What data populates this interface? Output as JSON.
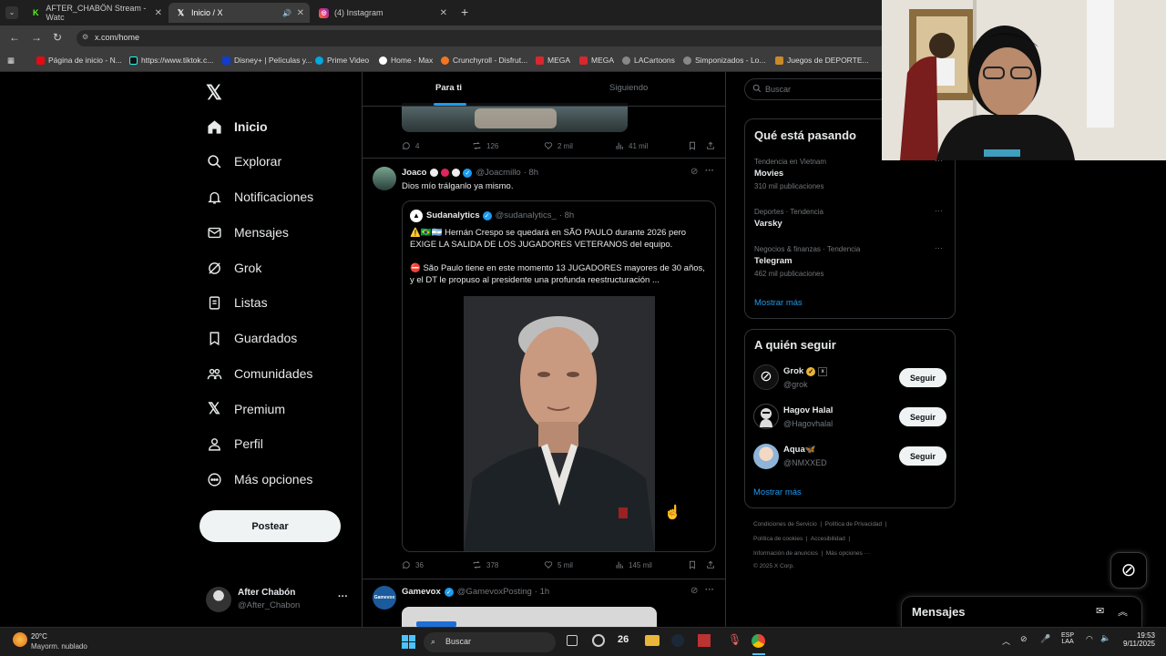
{
  "browser": {
    "tabs": [
      {
        "label": "AFTER_CHABÖN Stream - Watc"
      },
      {
        "label": "Inicio / X"
      },
      {
        "label": "(4) Instagram"
      }
    ],
    "new_tab": "+",
    "url": "x.com/home",
    "bookmarks": [
      {
        "label": "Página de inicio - N..."
      },
      {
        "label": "https://www.tiktok.c..."
      },
      {
        "label": "Disney+ | Películas y..."
      },
      {
        "label": "Prime Video"
      },
      {
        "label": "Home - Max"
      },
      {
        "label": "Crunchyroll - Disfrut..."
      },
      {
        "label": "MEGA"
      },
      {
        "label": "MEGA"
      },
      {
        "label": "LACartoons"
      },
      {
        "label": "Simponizados - Lo..."
      },
      {
        "label": "Juegos de DEPORTE..."
      }
    ]
  },
  "nav": {
    "items": [
      {
        "label": "Inicio",
        "icon": "home-icon"
      },
      {
        "label": "Explorar",
        "icon": "search-icon"
      },
      {
        "label": "Notificaciones",
        "icon": "bell-icon"
      },
      {
        "label": "Mensajes",
        "icon": "mail-icon"
      },
      {
        "label": "Grok",
        "icon": "grok-icon"
      },
      {
        "label": "Listas",
        "icon": "list-icon"
      },
      {
        "label": "Guardados",
        "icon": "bookmark-icon"
      },
      {
        "label": "Comunidades",
        "icon": "communities-icon"
      },
      {
        "label": "Premium",
        "icon": "x-icon"
      },
      {
        "label": "Perfil",
        "icon": "person-icon"
      },
      {
        "label": "Más opciones",
        "icon": "more-icon"
      }
    ],
    "post_button": "Postear",
    "account": {
      "name": "After Chabón",
      "handle": "@After_Chabon",
      "more": "···"
    }
  },
  "timeline": {
    "tabs": {
      "for_you": "Para ti",
      "following": "Siguiendo"
    },
    "prev_post_actions": {
      "replies": "4",
      "reposts": "126",
      "likes": "2 mil",
      "views": "41 mil"
    },
    "post": {
      "author": "Joaco",
      "handle": "@Joacmillo",
      "time": "· 8h",
      "text": "Dios mío trálganlo ya mismo.",
      "quote": {
        "author": "Sudanalytics",
        "handle": "@sudanalytics_",
        "time": "· 8h",
        "line1": "⚠️🇧🇷🇦🇷 Hernán Crespo se quedará en SÃO PAULO durante 2026 pero EXIGE LA SALIDA DE LOS JUGADORES VETERANOS del equipo.",
        "line2": "⛔ São Paulo tiene en este momento 13 JUGADORES mayores de 30 años, y el DT le propuso al presidente una profunda reestructuración ..."
      },
      "actions": {
        "replies": "36",
        "reposts": "378",
        "likes": "5 mil",
        "views": "145 mil"
      }
    },
    "next_post": {
      "author": "Gamevox",
      "handle": "@GamevoxPosting",
      "time": "· 1h",
      "avatar_text": "Gamevox"
    }
  },
  "sidebar": {
    "search_placeholder": "Buscar",
    "trends_title": "Qué está pasando",
    "trends": [
      {
        "context": "Tendencia en Vietnam",
        "name": "Movies",
        "count": "310 mil publicaciones"
      },
      {
        "context": "Deportes · Tendencia",
        "name": "Varsky",
        "count": ""
      },
      {
        "context": "Negocios & finanzas · Tendencia",
        "name": "Telegram",
        "count": "462 mil publicaciones"
      }
    ],
    "show_more": "Mostrar más",
    "who_title": "A quién seguir",
    "who": [
      {
        "name": "Grok",
        "handle": "@grok"
      },
      {
        "name": "Hagov Halal",
        "handle": "@Hagovhalal"
      },
      {
        "name": "Aqua🦋",
        "handle": "@NMXXED"
      }
    ],
    "follow_label": "Seguir",
    "who_show_more": "Mostrar más",
    "footer": [
      "Condiciones de Servicio",
      "Política de Privacidad",
      "Política de cookies",
      "Accesibilidad",
      "Información de anuncios",
      "Más opciones ···",
      "© 2025 X Corp."
    ]
  },
  "messages_dock": {
    "title": "Mensajes"
  },
  "taskbar": {
    "weather_temp": "20°C",
    "weather_desc": "Mayorm. nublado",
    "search": "Buscar",
    "lang1": "ESP",
    "lang2": "LAA",
    "time": "19:53",
    "date": "9/11/2025"
  },
  "colors": {
    "accent": "#1d9bf0",
    "bg": "#000000",
    "border": "#2f3336",
    "muted": "#71767b"
  }
}
